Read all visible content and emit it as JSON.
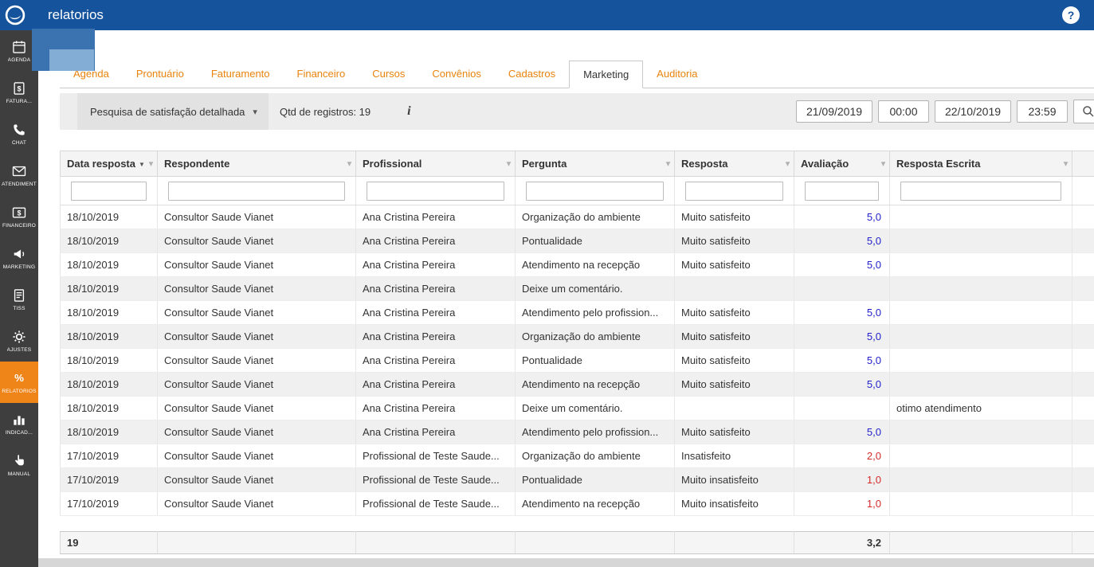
{
  "colors": {
    "topbar_blue": "#15549d",
    "sidebar_gray": "#3e3e3e",
    "active_orange": "#ef8418",
    "tab_orange": "#e8830c",
    "rating_blue": "#2222cc",
    "rating_red": "#d42b2b"
  },
  "icons": {
    "caret_down": "▾",
    "sort_desc": "▼"
  },
  "topbar": {
    "title": "relatorios",
    "help": "?"
  },
  "sidebar": {
    "items": [
      {
        "label": "AGENDA",
        "icon": "calendar-icon"
      },
      {
        "label": "FATURA...",
        "icon": "invoice-icon"
      },
      {
        "label": "CHAT",
        "icon": "phone-icon"
      },
      {
        "label": "ATENDIMENT",
        "icon": "envelope-icon"
      },
      {
        "label": "FINANCEIRO",
        "icon": "dollar-card-icon"
      },
      {
        "label": "MARKETING",
        "icon": "megaphone-icon"
      },
      {
        "label": "TISS",
        "icon": "document-icon"
      },
      {
        "label": "AJUSTES",
        "icon": "gear-icon"
      },
      {
        "label": "RELATORIOS",
        "icon": "percent-icon",
        "active": true
      },
      {
        "label": "INDICAD...",
        "icon": "bar-chart-icon"
      },
      {
        "label": "MANUAL",
        "icon": "hand-icon"
      }
    ]
  },
  "tabs": {
    "items": [
      "Agenda",
      "Prontuário",
      "Faturamento",
      "Financeiro",
      "Cursos",
      "Convênios",
      "Cadastros",
      "Marketing",
      "Auditoria"
    ],
    "active": "Marketing"
  },
  "toolbar": {
    "report_dropdown": "Pesquisa de satisfação detalhada",
    "records": "Qtd de registros: 19",
    "info": "i",
    "date_from": "21/09/2019",
    "time_from": "00:00",
    "date_to": "22/10/2019",
    "time_to": "23:59"
  },
  "table": {
    "columns": [
      "Data resposta",
      "Respondente",
      "Profissional",
      "Pergunta",
      "Resposta",
      "Avaliação",
      "Resposta Escrita"
    ],
    "rows": [
      {
        "date": "18/10/2019",
        "respondent": "Consultor Saude Vianet",
        "professional": "Ana Cristina Pereira",
        "question": "Organização do ambiente",
        "answer": "Muito satisfeito",
        "rating": "5,0",
        "rating_color": "blue",
        "written": ""
      },
      {
        "date": "18/10/2019",
        "respondent": "Consultor Saude Vianet",
        "professional": "Ana Cristina Pereira",
        "question": "Pontualidade",
        "answer": "Muito satisfeito",
        "rating": "5,0",
        "rating_color": "blue",
        "written": ""
      },
      {
        "date": "18/10/2019",
        "respondent": "Consultor Saude Vianet",
        "professional": "Ana Cristina Pereira",
        "question": "Atendimento na recepção",
        "answer": "Muito satisfeito",
        "rating": "5,0",
        "rating_color": "blue",
        "written": ""
      },
      {
        "date": "18/10/2019",
        "respondent": "Consultor Saude Vianet",
        "professional": "Ana Cristina Pereira",
        "question": "Deixe um comentário.",
        "answer": "",
        "rating": "",
        "rating_color": "",
        "written": ""
      },
      {
        "date": "18/10/2019",
        "respondent": "Consultor Saude Vianet",
        "professional": "Ana Cristina Pereira",
        "question": "Atendimento pelo profission...",
        "answer": "Muito satisfeito",
        "rating": "5,0",
        "rating_color": "blue",
        "written": ""
      },
      {
        "date": "18/10/2019",
        "respondent": "Consultor Saude Vianet",
        "professional": "Ana Cristina Pereira",
        "question": "Organização do ambiente",
        "answer": "Muito satisfeito",
        "rating": "5,0",
        "rating_color": "blue",
        "written": ""
      },
      {
        "date": "18/10/2019",
        "respondent": "Consultor Saude Vianet",
        "professional": "Ana Cristina Pereira",
        "question": "Pontualidade",
        "answer": "Muito satisfeito",
        "rating": "5,0",
        "rating_color": "blue",
        "written": ""
      },
      {
        "date": "18/10/2019",
        "respondent": "Consultor Saude Vianet",
        "professional": "Ana Cristina Pereira",
        "question": "Atendimento na recepção",
        "answer": "Muito satisfeito",
        "rating": "5,0",
        "rating_color": "blue",
        "written": ""
      },
      {
        "date": "18/10/2019",
        "respondent": "Consultor Saude Vianet",
        "professional": "Ana Cristina Pereira",
        "question": "Deixe um comentário.",
        "answer": "",
        "rating": "",
        "rating_color": "",
        "written": "otimo atendimento"
      },
      {
        "date": "18/10/2019",
        "respondent": "Consultor Saude Vianet",
        "professional": "Ana Cristina Pereira",
        "question": "Atendimento pelo profission...",
        "answer": "Muito satisfeito",
        "rating": "5,0",
        "rating_color": "blue",
        "written": ""
      },
      {
        "date": "17/10/2019",
        "respondent": "Consultor Saude Vianet",
        "professional": "Profissional de Teste Saude...",
        "question": "Organização do ambiente",
        "answer": "Insatisfeito",
        "rating": "2,0",
        "rating_color": "red",
        "written": ""
      },
      {
        "date": "17/10/2019",
        "respondent": "Consultor Saude Vianet",
        "professional": "Profissional de Teste Saude...",
        "question": "Pontualidade",
        "answer": "Muito insatisfeito",
        "rating": "1,0",
        "rating_color": "red",
        "written": ""
      },
      {
        "date": "17/10/2019",
        "respondent": "Consultor Saude Vianet",
        "professional": "Profissional de Teste Saude...",
        "question": "Atendimento na recepção",
        "answer": "Muito insatisfeito",
        "rating": "1,0",
        "rating_color": "red",
        "written": ""
      }
    ],
    "footer": {
      "count": "19",
      "avg": "3,2"
    }
  }
}
